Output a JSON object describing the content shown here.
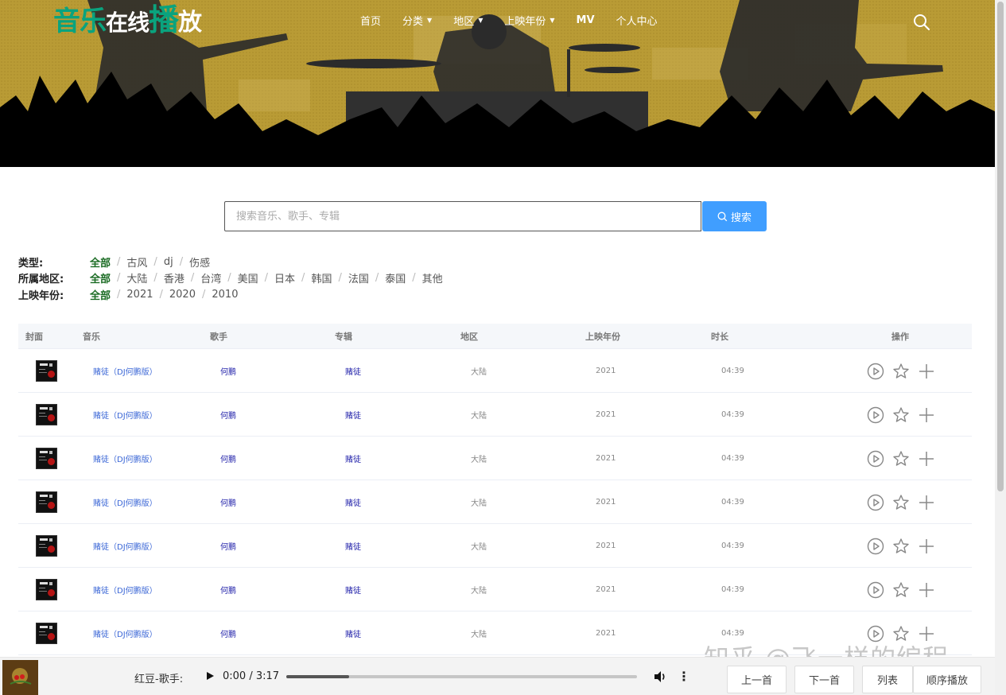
{
  "logo": {
    "part1": "音乐",
    "part2": "在线",
    "part3": "播",
    "part4": "放"
  },
  "nav": [
    {
      "label": "首页",
      "caret": false
    },
    {
      "label": "分类",
      "caret": true
    },
    {
      "label": "地区",
      "caret": true
    },
    {
      "label": "上映年份",
      "caret": true
    },
    {
      "label": "MV",
      "caret": false
    },
    {
      "label": "个人中心",
      "caret": false
    }
  ],
  "search": {
    "placeholder": "搜索音乐、歌手、专辑",
    "value": "",
    "button_label": "搜索"
  },
  "filters": [
    {
      "label": "类型:",
      "options": [
        "全部",
        "古风",
        "dj",
        "伤感"
      ],
      "active": 0
    },
    {
      "label": "所属地区:",
      "options": [
        "全部",
        "大陆",
        "香港",
        "台湾",
        "美国",
        "日本",
        "韩国",
        "法国",
        "泰国",
        "其他"
      ],
      "active": 0
    },
    {
      "label": "上映年份:",
      "options": [
        "全部",
        "2021",
        "2020",
        "2010"
      ],
      "active": 0
    }
  ],
  "table": {
    "headers": [
      "封面",
      "音乐",
      "歌手",
      "专辑",
      "地区",
      "上映年份",
      "时长",
      "操作"
    ],
    "rows": [
      {
        "music": "赌徒（DJ何鹏版）",
        "singer": "何鹏",
        "album": "赌徒",
        "region": "大陆",
        "year": "2021",
        "duration": "04:39"
      },
      {
        "music": "赌徒（DJ何鹏版）",
        "singer": "何鹏",
        "album": "赌徒",
        "region": "大陆",
        "year": "2021",
        "duration": "04:39"
      },
      {
        "music": "赌徒（DJ何鹏版）",
        "singer": "何鹏",
        "album": "赌徒",
        "region": "大陆",
        "year": "2021",
        "duration": "04:39"
      },
      {
        "music": "赌徒（DJ何鹏版）",
        "singer": "何鹏",
        "album": "赌徒",
        "region": "大陆",
        "year": "2021",
        "duration": "04:39"
      },
      {
        "music": "赌徒（DJ何鹏版）",
        "singer": "何鹏",
        "album": "赌徒",
        "region": "大陆",
        "year": "2021",
        "duration": "04:39"
      },
      {
        "music": "赌徒（DJ何鹏版）",
        "singer": "何鹏",
        "album": "赌徒",
        "region": "大陆",
        "year": "2021",
        "duration": "04:39"
      },
      {
        "music": "赌徒（DJ何鹏版）",
        "singer": "何鹏",
        "album": "赌徒",
        "region": "大陆",
        "year": "2021",
        "duration": "04:39"
      }
    ]
  },
  "player": {
    "title": "红豆-歌手:",
    "time": "0:00 / 3:17",
    "progress_fraction": 0.18,
    "buttons": [
      "上一首",
      "下一首",
      "列表",
      "顺序播放"
    ]
  },
  "watermark": "知乎 @飞一样的编程",
  "colors": {
    "accent": "#409eff",
    "logo_green": "#0aa37e",
    "active_filter": "#1a6b23",
    "banner": "#b89a32"
  }
}
